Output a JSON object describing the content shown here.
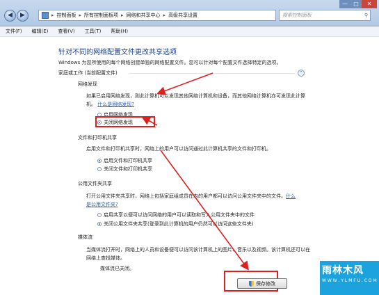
{
  "window": {
    "nav_back": "◀",
    "nav_forward": "▶",
    "breadcrumb": [
      "控制面板",
      "所有控制面板项",
      "网络和共享中心",
      "高级共享设置"
    ],
    "search_placeholder": "搜索控制面板",
    "controls": [
      "—",
      "▢",
      "✕"
    ]
  },
  "menu": [
    "文件(F)",
    "编辑(E)",
    "查看(V)",
    "工具(T)",
    "帮助(H)"
  ],
  "page": {
    "heading": "针对不同的网络配置文件更改共享选项",
    "intro": "Windows 为您所使用的每个网络创建单独的网络配置文件。您可以针对每个配置文件选择特定的选项。",
    "profile_title": "家庭或工作 (当前配置文件)",
    "collapse_icon": "⌃"
  },
  "network_discovery": {
    "title": "网络发现",
    "desc": "如果已启用网络发现，则此计算机可以发现其他网络计算机和设备，而其他网络计算机亦可发现此计算机。",
    "link": "什么是网络发现?",
    "options": [
      "启用网络发现",
      "关闭网络发现"
    ],
    "selected": 1
  },
  "file_printer": {
    "title": "文件和打印机共享",
    "desc": "启用文件和打印机共享时，网络上的用户可以访问通过此计算机共享的文件和打印机。",
    "options": [
      "启用文件和打印机共享",
      "关闭文件和打印机共享"
    ],
    "selected": 0
  },
  "public_folder": {
    "title": "公用文件夹共享",
    "desc": "打开公用文件夹共享时，网络上包括家庭组成员在内的用户都可以访问公用文件夹中的文件。",
    "link1": "什么",
    "link2": "是公用文件夹?",
    "options": [
      "启用共享以便可以访问网络的用户可以读取和写入公用文件夹中的文件",
      "关闭公用文件夹共享(登录到此计算机的用户仍然可以访问这些文件夹)"
    ],
    "selected": 1
  },
  "media": {
    "title": "媒体流",
    "desc": "当媒体流打开时，网络上的人员和设备便可以访问该计算机上的图片、音乐以及视频。该计算机还可以在网络上查找媒体。",
    "status": "媒体流已关闭。"
  },
  "buttons": {
    "save": "保存修改"
  },
  "watermark": {
    "title": "雨林木风",
    "url": "W W W . Y L M F U . C O M"
  },
  "colors": {
    "accent": "#1b3f8b",
    "highlight_box": "#e01e1e",
    "watermark_bg": "#1ca3dd"
  }
}
